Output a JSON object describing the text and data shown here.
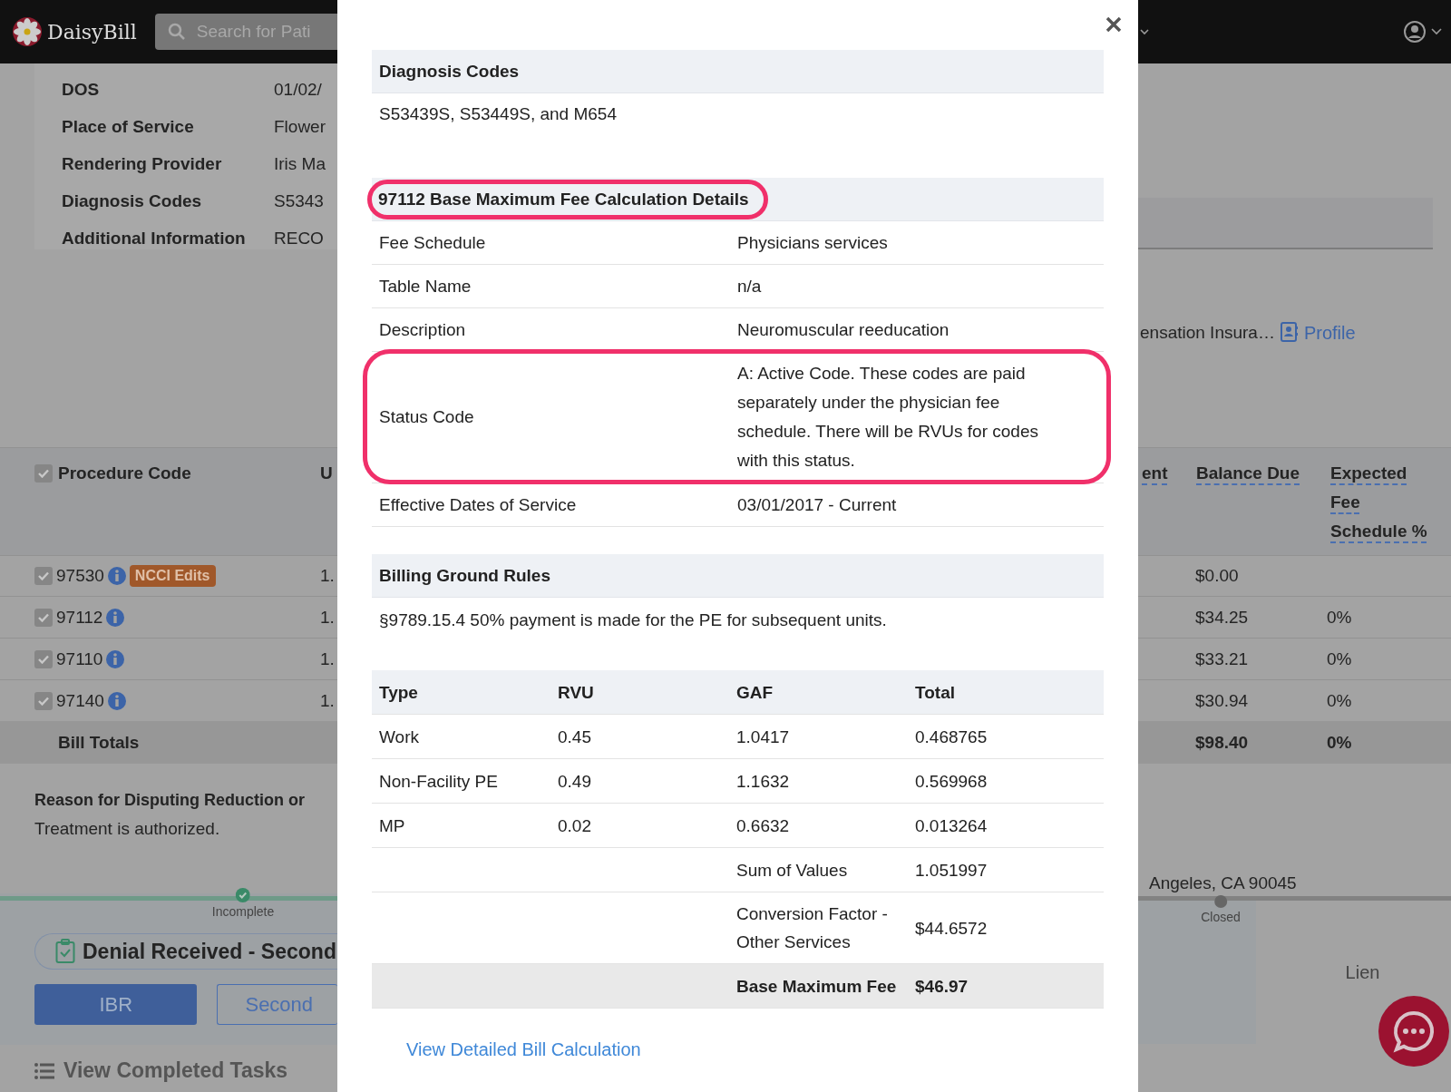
{
  "header": {
    "logo": "DaisyBill",
    "search": {
      "placeholder": "Search for Pati"
    }
  },
  "claim_info": [
    {
      "label": "DOS",
      "value": "01/02/"
    },
    {
      "label": "Place of Service",
      "value": "Flower"
    },
    {
      "label": "Rendering Provider",
      "value": "Iris Ma"
    },
    {
      "label": "Diagnosis Codes",
      "value": "S5343"
    },
    {
      "label": "Additional Information",
      "value": "RECO"
    }
  ],
  "payer": {
    "name": "ensation Insura…",
    "link": "Profile"
  },
  "procedures": {
    "select_all": {
      "checked": true
    },
    "columns": [
      "Procedure Code",
      "U"
    ],
    "right_columns": [
      "ent",
      "Balance Due",
      "Expected Fee Schedule %"
    ],
    "rows": [
      {
        "code": "97530",
        "checked": true,
        "badge": "NCCI Edits",
        "units": "1.",
        "balance": "$0.00"
      },
      {
        "code": "97112",
        "checked": true,
        "units": "1.",
        "balance": "$34.25",
        "percent": "0%"
      },
      {
        "code": "97110",
        "checked": true,
        "units": "1.",
        "balance": "$33.21",
        "percent": "0%"
      },
      {
        "code": "97140",
        "checked": true,
        "units": "1.",
        "balance": "$30.94",
        "percent": "0%"
      }
    ],
    "totals": {
      "label": "Bill Totals",
      "balance": "$98.40",
      "percent": "0%"
    }
  },
  "reason": {
    "label": "Reason for Disputing Reduction or",
    "text": "Treatment is authorized."
  },
  "address": "Angeles, CA 90045",
  "progress": [
    {
      "label": "Incomplete",
      "done": true
    },
    {
      "label": "Closed",
      "done": false
    }
  ],
  "task": {
    "title": "Denial Received - Second",
    "buttons": [
      {
        "label": "IBR",
        "kind": "primary"
      },
      {
        "label": "Second",
        "kind": "outline"
      }
    ],
    "lien": "Lien"
  },
  "completed_tasks": "View Completed Tasks",
  "modal": {
    "diagnosis": {
      "title": "Diagnosis Codes",
      "text": "S53439S, S53449S, and M654"
    },
    "details": {
      "title": "97112 Base Maximum Fee Calculation Details",
      "highlighted": true,
      "rows": [
        {
          "label": "Fee Schedule",
          "value": "Physicians services",
          "highlighted": false
        },
        {
          "label": "Table Name",
          "value": "n/a",
          "highlighted": false
        },
        {
          "label": "Description",
          "value": "Neuromuscular reeducation",
          "highlighted": false
        },
        {
          "label": "Status Code",
          "value": "A: Active Code. These codes are paid separately under the physician fee schedule. There will be RVUs for codes with this status.",
          "highlighted": true
        },
        {
          "label": "Effective Dates of Service",
          "value": "03/01/2017 - Current",
          "highlighted": false
        }
      ]
    },
    "rules": {
      "title": "Billing Ground Rules",
      "text": "§9789.15.4 50% payment is made for the PE for subsequent units."
    },
    "rvu": {
      "columns": [
        "Type",
        "RVU",
        "GAF",
        "Total"
      ],
      "rows": [
        {
          "cells": [
            "Work",
            "0.45",
            "1.0417",
            "0.468765"
          ]
        },
        {
          "cells": [
            "Non-Facility PE",
            "0.49",
            "1.1632",
            "0.569968"
          ]
        },
        {
          "cells": [
            "MP",
            "0.02",
            "0.6632",
            "0.013264"
          ]
        }
      ],
      "summary": [
        {
          "label": "Sum of Values",
          "value": "1.051997",
          "kind": "plain"
        },
        {
          "label": "Conversion Factor - Other Services",
          "value": "$44.6572",
          "kind": "plain"
        },
        {
          "label": "Base Maximum Fee",
          "value": "$46.97",
          "kind": "total"
        }
      ]
    },
    "link": "View Detailed Bill Calculation"
  }
}
